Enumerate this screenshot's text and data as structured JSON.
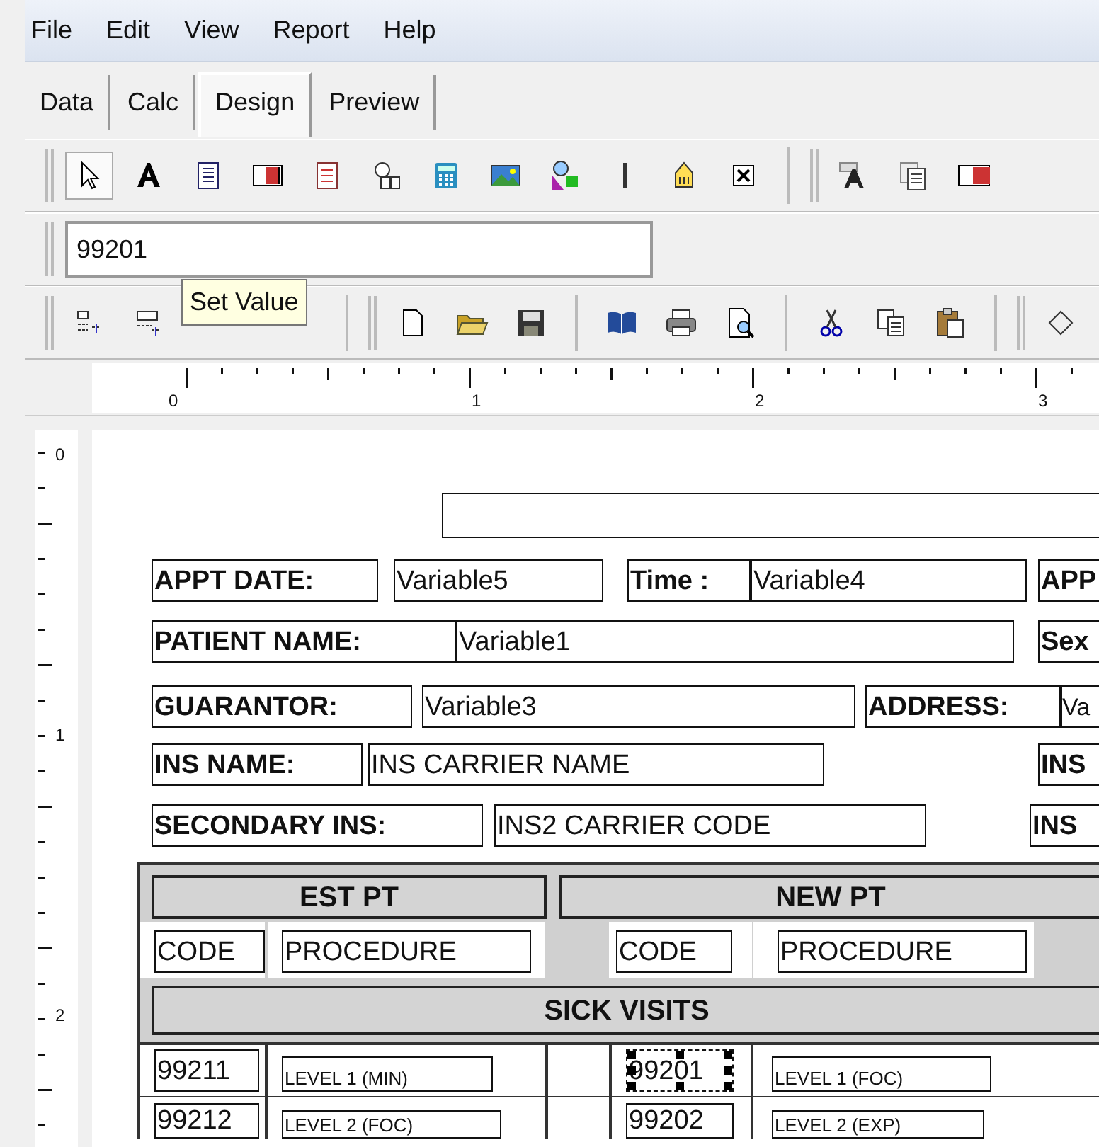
{
  "menu": [
    "File",
    "Edit",
    "View",
    "Report",
    "Help"
  ],
  "tabs": [
    {
      "label": "Data",
      "selected": false
    },
    {
      "label": "Calc",
      "selected": false
    },
    {
      "label": "Design",
      "selected": true
    },
    {
      "label": "Preview",
      "selected": false
    }
  ],
  "value_field": {
    "value": "99201"
  },
  "tooltip": "Set Value",
  "ruler": {
    "marks": [
      "0",
      "1",
      "2",
      "3"
    ]
  },
  "vertical_ruler": {
    "marks": [
      "0",
      "1",
      "2"
    ]
  },
  "report": {
    "items": [
      {
        "kind": "box",
        "selected": false
      },
      {
        "kind": "label",
        "text": "APPT DATE:",
        "selected": false
      },
      {
        "kind": "field",
        "text": "Variable5",
        "selected": false
      },
      {
        "kind": "label",
        "text": "Time :",
        "selected": false
      },
      {
        "kind": "field",
        "text": "Variable4",
        "selected": false
      },
      {
        "kind": "label",
        "text": "APP",
        "selected": false
      },
      {
        "kind": "label",
        "text": "PATIENT NAME:",
        "selected": false
      },
      {
        "kind": "field",
        "text": "Variable1",
        "selected": false
      },
      {
        "kind": "label",
        "text": "Sex",
        "selected": false
      },
      {
        "kind": "label",
        "text": "GUARANTOR:",
        "selected": false
      },
      {
        "kind": "field",
        "text": "Variable3",
        "selected": false
      },
      {
        "kind": "label",
        "text": "ADDRESS:",
        "selected": false
      },
      {
        "kind": "field",
        "text": "Va",
        "selected": false
      },
      {
        "kind": "label",
        "text": "INS NAME:",
        "selected": false
      },
      {
        "kind": "field",
        "text": "INS CARRIER NAME",
        "selected": false
      },
      {
        "kind": "label",
        "text": "INS",
        "selected": false
      },
      {
        "kind": "label",
        "text": "SECONDARY INS:",
        "selected": false
      },
      {
        "kind": "field",
        "text": "INS2 CARRIER CODE",
        "selected": false
      },
      {
        "kind": "label",
        "text": "INS",
        "selected": false
      },
      {
        "kind": "header",
        "text": "EST PT",
        "selected": false
      },
      {
        "kind": "header",
        "text": "NEW PT",
        "selected": false
      },
      {
        "kind": "field",
        "text": "CODE",
        "selected": false
      },
      {
        "kind": "field",
        "text": "PROCEDURE",
        "selected": false
      },
      {
        "kind": "field",
        "text": "CODE",
        "selected": false
      },
      {
        "kind": "field",
        "text": "PROCEDURE",
        "selected": false
      },
      {
        "kind": "header",
        "text": "SICK VISITS",
        "selected": false
      },
      {
        "kind": "field",
        "text": "99211",
        "selected": false
      },
      {
        "kind": "small",
        "text": "LEVEL 1 (MIN)",
        "selected": false
      },
      {
        "kind": "field",
        "text": "99201",
        "selected": true
      },
      {
        "kind": "small",
        "text": "LEVEL 1 (FOC)",
        "selected": false
      },
      {
        "kind": "field",
        "text": "99212",
        "selected": false
      },
      {
        "kind": "small",
        "text": "LEVEL 2 (FOC)",
        "selected": false
      },
      {
        "kind": "field",
        "text": "99202",
        "selected": false
      },
      {
        "kind": "small",
        "text": "LEVEL 2 (EXP)",
        "selected": false
      }
    ]
  }
}
